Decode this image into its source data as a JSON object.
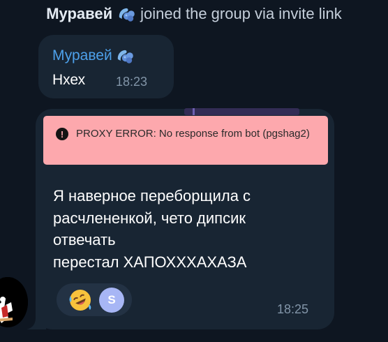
{
  "service_message": {
    "sender": "Муравей",
    "sender_icon": "blueberry-emoji-icon",
    "action": "joined the group via invite link"
  },
  "messages": [
    {
      "sender": "Муравей",
      "sender_icon": "blueberry-emoji-icon",
      "sender_color": "#4da0ea",
      "text": "Нхех",
      "time": "18:23"
    },
    {
      "error": {
        "icon": "exclamation-circle-icon",
        "text": "PROXY ERROR: No response from bot (pgshag2)",
        "bg_color": "#fda8ad"
      },
      "text_lines": [
        "Я наверное переборщила с",
        "расчлененкой, чето дипсик",
        "отвечать",
        "перестал ХАПОХХХАХАЗА"
      ],
      "reactions": {
        "emoji": "rolling-on-floor-laughing-emoji",
        "user_initial": "S"
      },
      "time": "18:25"
    }
  ],
  "colors": {
    "background": "#0e1621",
    "bubble": "#182533",
    "time": "#8295a8"
  }
}
